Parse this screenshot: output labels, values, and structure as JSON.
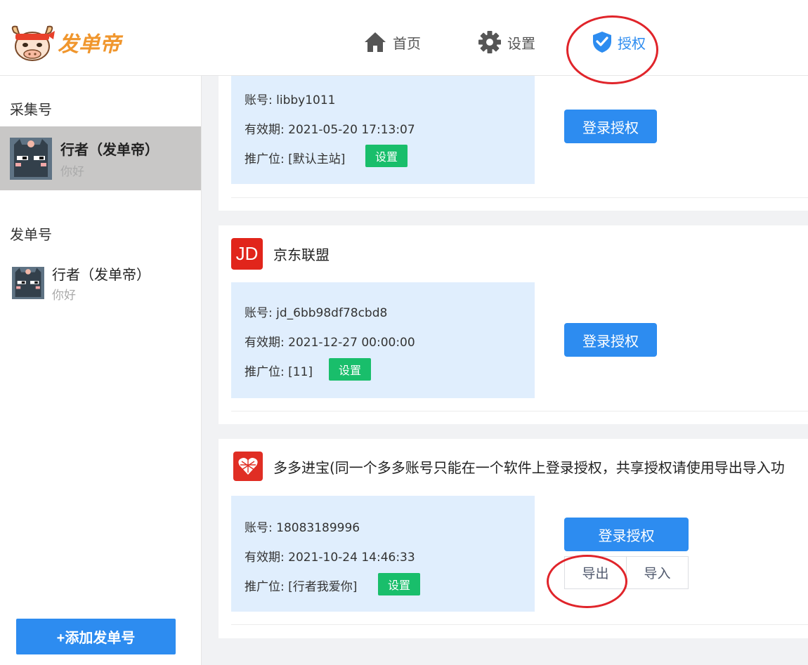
{
  "header": {
    "logo_text": "发单帝",
    "nav": [
      {
        "label": "首页",
        "icon": "home-icon"
      },
      {
        "label": "设置",
        "icon": "gear-icon"
      },
      {
        "label": "授权",
        "icon": "shield-check-icon"
      }
    ],
    "active_color": "#2d8cf0"
  },
  "sidebar": {
    "collect_title": "采集号",
    "collect_accounts": [
      {
        "name": "行者（发单帝）",
        "sub": "你好",
        "selected": true
      }
    ],
    "send_title": "发单号",
    "send_accounts": [
      {
        "name": "行者（发单帝）",
        "sub": "你好",
        "selected": false
      }
    ],
    "add_button": "+添加发单号"
  },
  "cards": [
    {
      "platform": "",
      "account": "账号: libby1011",
      "expiry": "有效期: 2021-05-20 17:13:07",
      "position": "推广位: [默认主站]",
      "set_label": "设置",
      "login_label": "登录授权"
    },
    {
      "platform": "京东联盟",
      "icon_text": "JD",
      "account": "账号: jd_6bb98df78cbd8",
      "expiry": "有效期: 2021-12-27 00:00:00",
      "position": "推广位: [11]",
      "set_label": "设置",
      "login_label": "登录授权"
    },
    {
      "platform": "多多进宝(同一个多多账号只能在一个软件上登录授权，共享授权请使用导出导入功",
      "account": "账号: 18083189996",
      "expiry": "有效期: 2021-10-24 14:46:33",
      "position": "推广位: [行者我爱你]",
      "set_label": "设置",
      "login_label": "登录授权",
      "export_label": "导出",
      "import_label": "导入"
    }
  ],
  "colors": {
    "primary": "#2d8cf0",
    "success": "#19be6b",
    "jd_red": "#e1251b",
    "pdd_red": "#e02e24",
    "annotation": "#e0242a"
  }
}
